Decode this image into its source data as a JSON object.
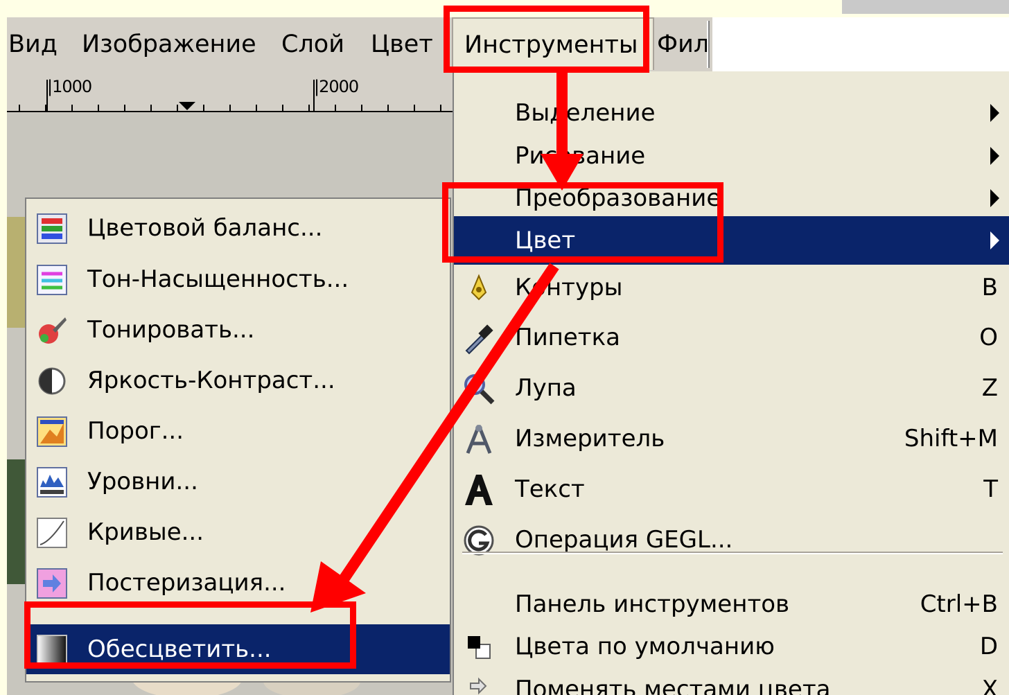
{
  "menubar": {
    "items": [
      "Вид",
      "Изображение",
      "Слой",
      "Цвет",
      "Инструменты",
      "Фил"
    ]
  },
  "ruler": {
    "ticks": [
      "|1000",
      "|2000"
    ]
  },
  "tools_menu": {
    "items": [
      {
        "label": "Выделение",
        "accel": "",
        "submenu": true,
        "icon": ""
      },
      {
        "label": "Рисование",
        "accel": "",
        "submenu": true,
        "icon": ""
      },
      {
        "label": "Преобразование",
        "accel": "",
        "submenu": true,
        "icon": ""
      },
      {
        "label": "Цвет",
        "accel": "",
        "submenu": true,
        "icon": ""
      },
      {
        "label": "Контуры",
        "accel": "B",
        "submenu": false,
        "icon": "paths-icon"
      },
      {
        "label": "Пипетка",
        "accel": "O",
        "submenu": false,
        "icon": "color-picker-icon"
      },
      {
        "label": "Лупа",
        "accel": "Z",
        "submenu": false,
        "icon": "magnify-icon"
      },
      {
        "label": "Измеритель",
        "accel": "Shift+M",
        "submenu": false,
        "icon": "measure-icon"
      },
      {
        "label": "Текст",
        "accel": "T",
        "submenu": false,
        "icon": "text-icon"
      },
      {
        "label": "Операция GEGL...",
        "accel": "",
        "submenu": false,
        "icon": "gegl-icon"
      },
      {
        "label": "Панель инструментов",
        "accel": "Ctrl+B",
        "submenu": false,
        "icon": ""
      },
      {
        "label": "Цвета по умолчанию",
        "accel": "D",
        "submenu": false,
        "icon": "default-colors-icon"
      },
      {
        "label": "Поменять местами цвета",
        "accel": "X",
        "submenu": false,
        "icon": "swap-colors-icon"
      }
    ]
  },
  "color_menu": {
    "items": [
      {
        "label": "Цветовой баланс...",
        "icon": "color-balance-icon"
      },
      {
        "label": "Тон-Насыщенность...",
        "icon": "hue-saturation-icon"
      },
      {
        "label": "Тонировать...",
        "icon": "colorize-icon"
      },
      {
        "label": "Яркость-Контраст...",
        "icon": "brightness-contrast-icon"
      },
      {
        "label": "Порог...",
        "icon": "threshold-icon"
      },
      {
        "label": "Уровни...",
        "icon": "levels-icon"
      },
      {
        "label": "Кривые...",
        "icon": "curves-icon"
      },
      {
        "label": "Постеризация...",
        "icon": "posterize-icon"
      },
      {
        "label": "Обесцветить...",
        "icon": "desaturate-icon"
      }
    ]
  },
  "colors": {
    "menu_bg": "#ece9d8",
    "window_bg": "#d4d0c8",
    "highlight": "#0a246a",
    "annotation": "#ff0000"
  }
}
